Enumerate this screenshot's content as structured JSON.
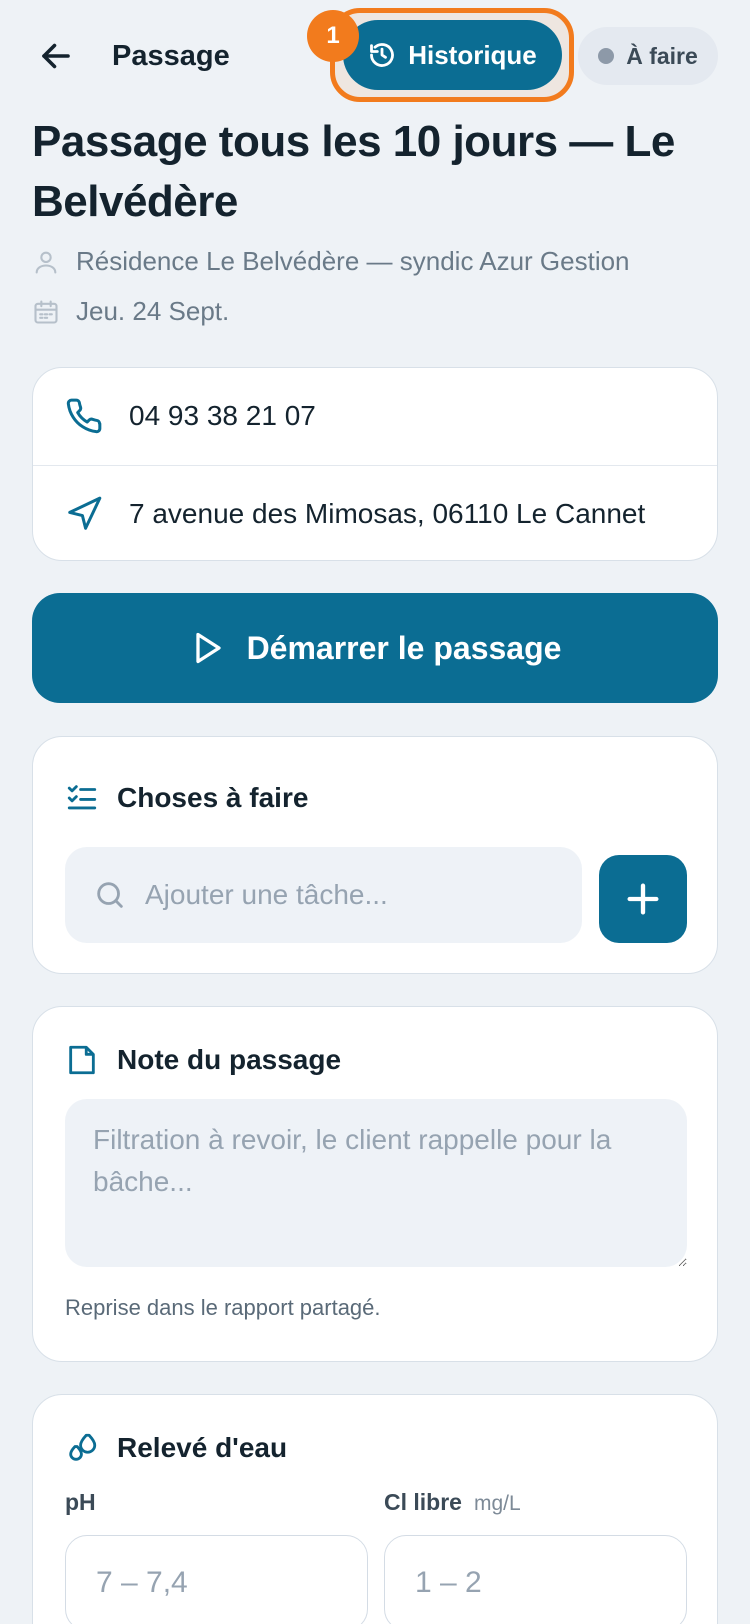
{
  "header": {
    "title": "Passage",
    "history_label": "Historique",
    "step_badge": "1",
    "status_label": "À faire"
  },
  "page": {
    "title": "Passage tous les 10 jours — Le Belvédère",
    "client": "Résidence Le Belvédère — syndic Azur Gestion",
    "date": "Jeu. 24 Sept."
  },
  "contact": {
    "phone": "04 93 38 21 07",
    "address": "7 avenue des Mimosas, 06110 Le Cannet"
  },
  "actions": {
    "start_label": "Démarrer le passage"
  },
  "todo": {
    "title": "Choses à faire",
    "placeholder": "Ajouter une tâche..."
  },
  "note": {
    "title": "Note du passage",
    "placeholder": "Filtration à revoir, le client rappelle pour la bâche...",
    "hint": "Reprise dans le rapport partagé."
  },
  "water": {
    "title": "Relevé d'eau",
    "ph_label": "pH",
    "ph_placeholder": "7 – 7,4",
    "cl_label": "Cl libre",
    "cl_unit": "mg/L",
    "cl_placeholder": "1 – 2"
  },
  "colors": {
    "primary": "#0b6d93",
    "highlight": "#f27b1d",
    "background": "#eef2f6"
  },
  "icons": {
    "back": "arrow-left-icon",
    "history": "history-icon",
    "user": "user-icon",
    "calendar": "calendar-icon",
    "phone": "phone-icon",
    "navigation": "navigation-icon",
    "play": "play-icon",
    "checklist": "checklist-icon",
    "search": "search-icon",
    "plus": "plus-icon",
    "note": "note-icon",
    "droplets": "droplets-icon"
  }
}
